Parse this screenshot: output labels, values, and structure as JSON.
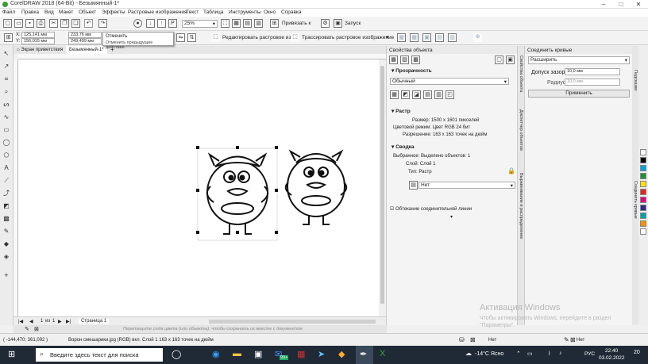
{
  "window": {
    "title": "CorelDRAW 2018 (64-Bit) - Безымянный-1*"
  },
  "menu": [
    "Файл",
    "Правка",
    "Вид",
    "Макет",
    "Объект",
    "Эффекты",
    "Растровые изображения",
    "Текст",
    "Таблица",
    "Инструменты",
    "Окно",
    "Справка"
  ],
  "toolbar": {
    "zoom": "25%",
    "snap": "Привязать к",
    "launch": "Запуск"
  },
  "propbar": {
    "x": "125,141 мм",
    "y": "156,015 мм",
    "w": "233,76 мм",
    "h": "249,499 мм",
    "edit_bitmap": "Редактировать растровое из...",
    "trace_bitmap": "Трассировать растровое изображение"
  },
  "tooltip": {
    "title": "Отменить",
    "desc": "Отменить предыдущее действие."
  },
  "doc_tabs": [
    "Экран приветствия",
    "Безымянный-1*"
  ],
  "page_nav": {
    "current": "1",
    "of": "из",
    "total": "1",
    "page_label": "Страница 1"
  },
  "docbar_hint": "Перетащите сюда цвета (или объекты), чтобы сохранить их вместе с документом",
  "props": {
    "title": "Свойства объекта",
    "transparency": "Прозрачность",
    "blend": "Обычный",
    "raster": "Растр",
    "size": "Размер: 1500 x 1601 пикселей",
    "colormode": "Цветовой режим: Цвет RGB 24 бит",
    "resolution": "Разрешение: 163 x 163 точек на дюйм",
    "summary": "Сводка",
    "selected": "Выбранное: Выделено объектов: 1",
    "layer": "Слой: Слой 1",
    "type": "Тип: Растр",
    "net": "Нет",
    "wrap": "Обтекание соединительной линии"
  },
  "vtabs_left": [
    "Свойства объекта",
    "Диспетчер объектов",
    "Выравнивание и распределение"
  ],
  "curves": {
    "title": "Соединить кривые",
    "mode": "Расширить",
    "gap_label": "Допуск зазора:",
    "gap": "10,0 мм",
    "radius_label": "Радиус:",
    "radius": "10,0 мм",
    "apply": "Применить"
  },
  "vtabs_right": [
    "Подсказки",
    "Соединить кривые"
  ],
  "palette": [
    "#ffffff",
    "#000000",
    "#00a0e0",
    "#1f8f3a",
    "#ffe500",
    "#e52322",
    "#e5007e",
    "#2c2a8b",
    "#00a3a6",
    "#f39200",
    "#ffffff"
  ],
  "status": {
    "coords": "( -144,470; 361,092 )",
    "info": "Ворон смешарики.jpg (RGB) вкл. Слой 1 163 x 163 точек на дюйм",
    "fill": "Нет",
    "outline": "Нет"
  },
  "watermark": {
    "title": "Активация Windows",
    "sub": "Чтобы активировать Windows, перейдите в раздел \"Параметры\"."
  },
  "taskbar": {
    "search": "Введите здесь текст для поиска",
    "badge": "99+",
    "weather": "-14°C Ясно",
    "lang": "РУС",
    "time": "22:40",
    "date": "03.02.2022",
    "notif": "20"
  }
}
